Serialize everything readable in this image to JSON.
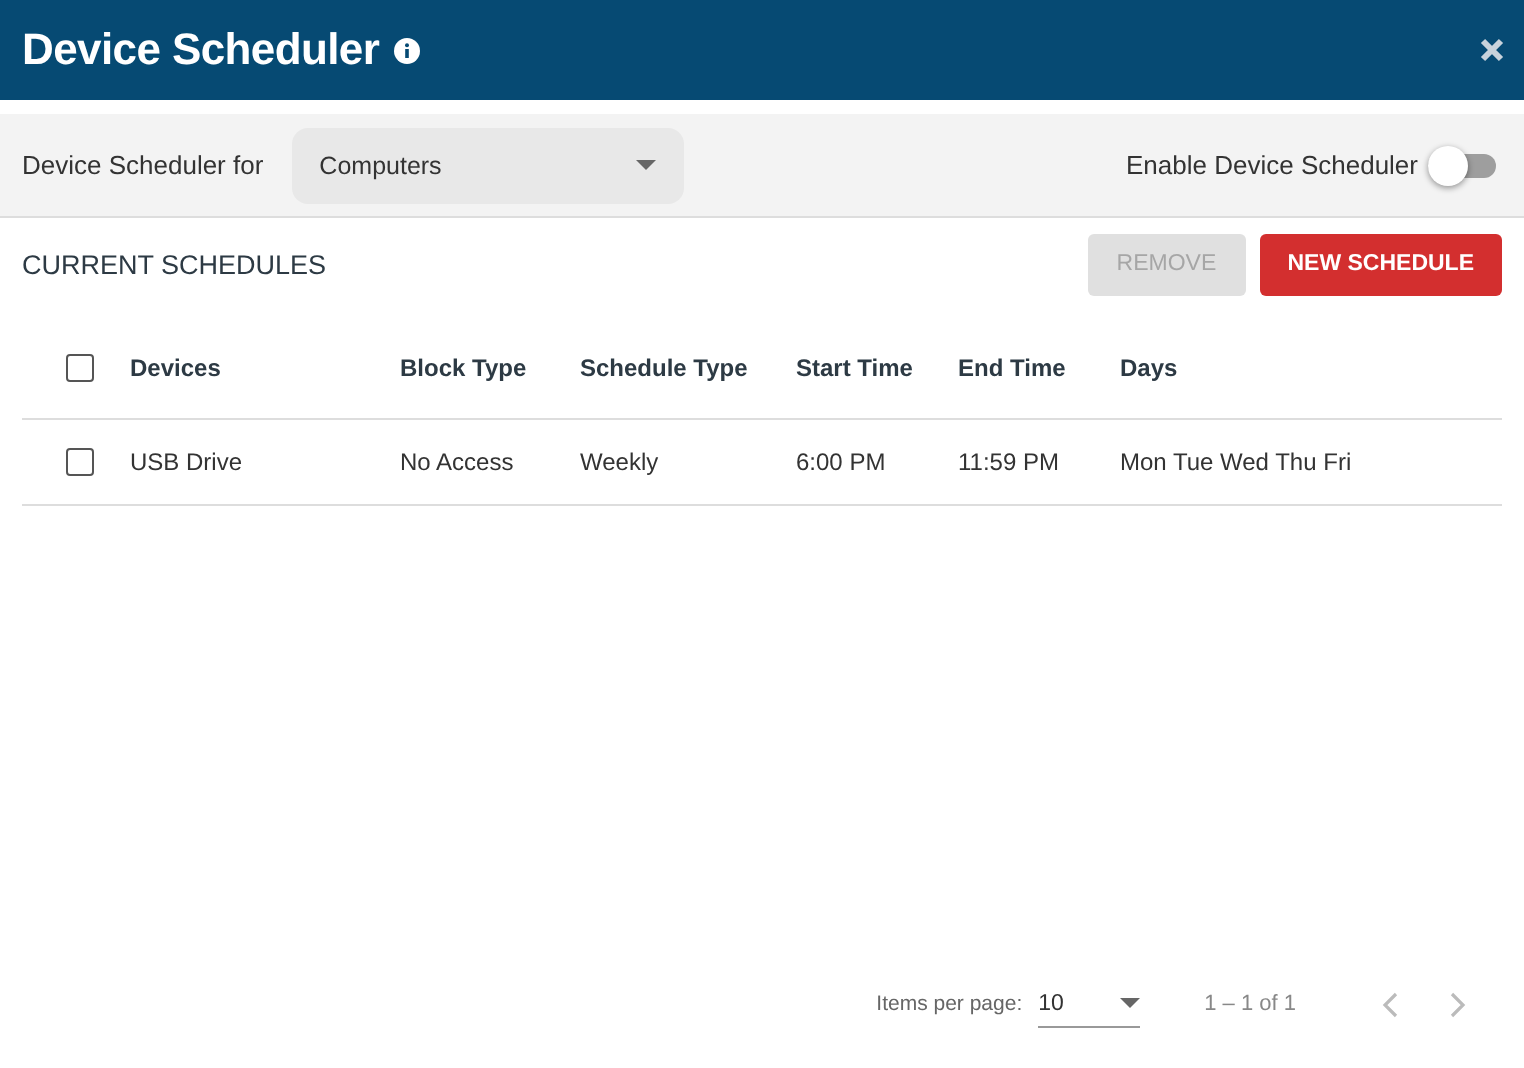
{
  "window": {
    "title": "Device Scheduler"
  },
  "toolbar": {
    "label": "Device Scheduler for",
    "select_value": "Computers",
    "toggle_label": "Enable Device Scheduler",
    "toggle_on": false
  },
  "section": {
    "title": "CURRENT SCHEDULES",
    "buttons": [
      {
        "label": "REMOVE",
        "disabled": true,
        "kind": "secondary"
      },
      {
        "label": "NEW SCHEDULE",
        "disabled": false,
        "kind": "primary"
      }
    ]
  },
  "table": {
    "select_all_checked": false,
    "columns": [
      "Devices",
      "Block Type",
      "Schedule Type",
      "Start Time",
      "End Time",
      "Days"
    ],
    "rows": [
      {
        "checked": false,
        "cells": [
          "USB Drive",
          "No Access",
          "Weekly",
          "6:00 PM",
          "11:59 PM",
          "Mon Tue Wed Thu Fri"
        ]
      }
    ]
  },
  "paginator": {
    "label": "Items per page:",
    "page_size": "10",
    "range": "1 – 1 of 1",
    "prev_disabled": true,
    "next_disabled": true
  }
}
